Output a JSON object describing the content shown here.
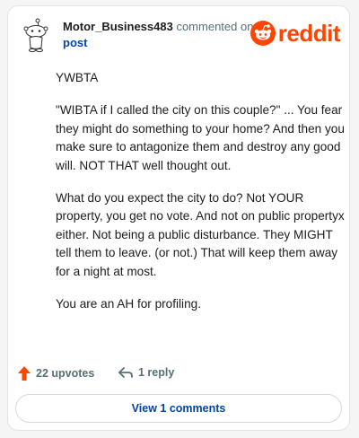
{
  "header": {
    "username": "Motor_Business483",
    "action": "commented on",
    "post_link": "post",
    "logo_text": "reddit"
  },
  "comment": {
    "paragraphs": [
      "YWBTA",
      "\"WIBTA if I called the city on this couple?\" ... You fear they might do something to your home? And then you make sure to antagonize them and destroy any good will. NOT THAT well thought out.",
      "What do you expect the city to do? Not YOUR property, you get no vote. And not on public propertyx either. Not being a public disturbance. They MIGHT tell them to leave. (or not.) That will keep them away for a night at most.",
      "You are an AH for profiling."
    ]
  },
  "footer": {
    "upvotes": "22 upvotes",
    "replies": "1 reply",
    "view_comments": "View 1 comments"
  },
  "colors": {
    "brand": "#ff4500",
    "link": "#0045ac",
    "muted": "#576f76"
  },
  "icons": [
    "snoo-avatar-icon",
    "reddit-logo-icon",
    "upvote-arrow-icon",
    "reply-arrow-icon"
  ]
}
